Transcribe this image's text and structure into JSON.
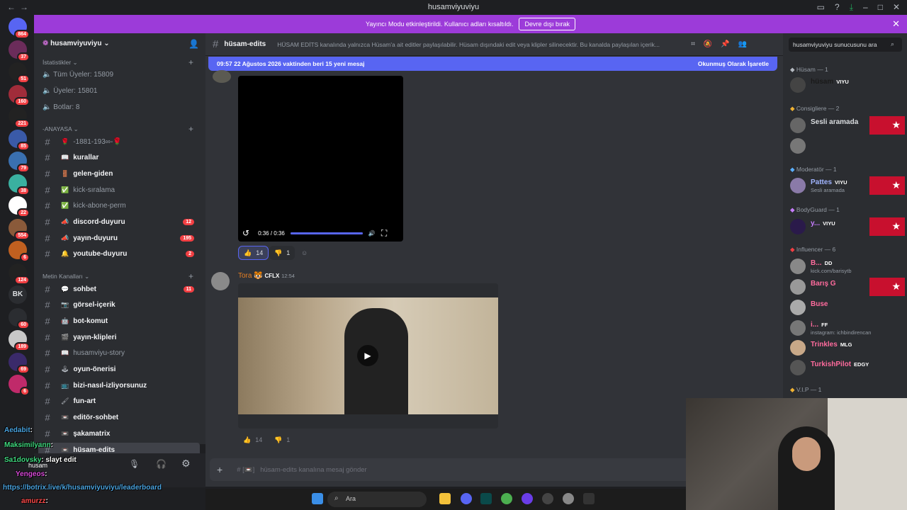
{
  "window": {
    "title": "husamviyuviyu"
  },
  "banner": {
    "text": "Yayıncı Modu etkinleştirildi. Kullanıcı adları kısaltıldı.",
    "button": "Devre dışı bırak",
    "color": "#9c3bd9"
  },
  "rail": {
    "badges": [
      "864",
      "37",
      "51",
      "160",
      "221",
      "85",
      "79",
      "38",
      "22",
      "554",
      "6",
      "124",
      "BK",
      "60",
      "189",
      "69",
      "6"
    ]
  },
  "server": {
    "name": "husamviyuviyu"
  },
  "stats": {
    "category": "İstatistikler",
    "all_members": "Tüm Üyeler: 15809",
    "members": "Üyeler: 15801",
    "bots": "Botlar: 8"
  },
  "cat_anayasa": {
    "label": "-ANAYASA"
  },
  "cat_metin": {
    "label": "Metin Kanalları"
  },
  "channels_anayasa": [
    {
      "emoji": "🌹",
      "name": "-1881-193∞-🌹",
      "dim": true,
      "count": ""
    },
    {
      "emoji": "📖",
      "name": "kurallar",
      "dim": false,
      "count": ""
    },
    {
      "emoji": "🚪",
      "name": "gelen-giden",
      "dim": false,
      "count": ""
    },
    {
      "emoji": "✅",
      "name": "kick-sıralama",
      "dim": true,
      "count": ""
    },
    {
      "emoji": "✅",
      "name": "kick-abone-perm",
      "dim": true,
      "count": ""
    },
    {
      "emoji": "📣",
      "name": "discord-duyuru",
      "dim": false,
      "count": "12"
    },
    {
      "emoji": "📣",
      "name": "yayın-duyuru",
      "dim": false,
      "count": "195"
    },
    {
      "emoji": "🔔",
      "name": "youtube-duyuru",
      "dim": false,
      "count": "2"
    }
  ],
  "channels_metin": [
    {
      "emoji": "💬",
      "name": "sohbet",
      "dim": false,
      "count": "11"
    },
    {
      "emoji": "📷",
      "name": "görsel-içerik",
      "dim": false,
      "count": ""
    },
    {
      "emoji": "🤖",
      "name": "bot-komut",
      "dim": false,
      "count": ""
    },
    {
      "emoji": "🎬",
      "name": "yayın-klipleri",
      "dim": false,
      "count": ""
    },
    {
      "emoji": "📖",
      "name": "husamviyu-story",
      "dim": true,
      "count": ""
    },
    {
      "emoji": "🕹",
      "name": "oyun-önerisi",
      "dim": false,
      "count": ""
    },
    {
      "emoji": "📺",
      "name": "bizi-nasıl-izliyorsunuz",
      "dim": false,
      "count": ""
    },
    {
      "emoji": "🖌",
      "name": "fun-art",
      "dim": false,
      "count": ""
    },
    {
      "emoji": "📼",
      "name": "editör-sohbet",
      "dim": false,
      "count": ""
    },
    {
      "emoji": "📼",
      "name": "şakamatrix",
      "dim": false,
      "count": ""
    },
    {
      "emoji": "📼",
      "name": "hüsam-edits",
      "dim": false,
      "count": ""
    }
  ],
  "user": {
    "name": "husam"
  },
  "header": {
    "channel": "hüsam-edits",
    "topic": "HÜSAM EDİTS kanalında yalnızca Hüsam'a ait editler paylaşılabilir. Hüsam dışındaki edit veya klipler silinecektir. Bu kanalda paylaşılan içerik...",
    "search_placeholder": "husamviyuviyu sunucusunu ara"
  },
  "newbar": {
    "text": "09:57 22 Ağustos 2026 vaktinden beri 15 yeni mesaj",
    "action": "Okunmuş Olarak İşaretle"
  },
  "video1": {
    "time": "0:36 / 0:36",
    "progress": 1.0
  },
  "reactions1": {
    "thumbs": "14",
    "down": "1"
  },
  "message2": {
    "author": "Tora 🐯",
    "tag": "CFLX",
    "time": "12:54"
  },
  "reactions2": {
    "thumbs": "14",
    "down": "1"
  },
  "composer": {
    "placeholder": "hüsam-edits kanalına mesaj gönder"
  },
  "members": {
    "roles": [
      {
        "label": "Hüsam — 1"
      },
      {
        "label": "Consigliere — 2"
      },
      {
        "label": "Moderatör — 1"
      },
      {
        "label": "BodyGuard — 1"
      },
      {
        "label": "Influencer — 6"
      },
      {
        "label": "V.I.P — 1"
      }
    ],
    "list": [
      {
        "name": "hüsam",
        "tag": "VIYU",
        "sub": "",
        "color": "#1a1a1a"
      },
      {
        "name": "Sesli aramada",
        "tag": "",
        "sub": "",
        "color": "#dbdee1"
      },
      {
        "name": "",
        "tag": "",
        "sub": "",
        "color": "#dbdee1"
      },
      {
        "name": "Pattes",
        "tag": "VIYU",
        "sub": "Sesli aramada",
        "color": "#a0b4ff"
      },
      {
        "name": "y...",
        "tag": "VIYU",
        "sub": "",
        "color": "#c77dff"
      },
      {
        "name": "B...",
        "tag": "DD",
        "sub": "kick.com/barisytb",
        "color": "#ff6b9d"
      },
      {
        "name": "Barış G",
        "tag": "",
        "sub": "",
        "color": "#ff6b9d"
      },
      {
        "name": "Buse",
        "tag": "",
        "sub": "",
        "color": "#ff6b9d"
      },
      {
        "name": "i...",
        "tag": "FF",
        "sub": "instagram: ichbindirencan",
        "color": "#ff6b9d"
      },
      {
        "name": "Trinkles",
        "tag": "MLG",
        "sub": "",
        "color": "#ff6b9d"
      },
      {
        "name": "TurkishPilot",
        "tag": "EDGY",
        "sub": "",
        "color": "#ff6b9d"
      }
    ]
  },
  "chat_overlay": [
    {
      "user": "Aedabit",
      "text": ":",
      "color": "#4aa3df"
    },
    {
      "user": "Maksimilyann",
      "text": ":",
      "color": "#3fd97e"
    },
    {
      "user": "Sa1dovsky",
      "text": ": slayt edit",
      "color": "#3fd97e"
    },
    {
      "user": "Yengeos",
      "text": ":",
      "color": "#d94ad9"
    },
    {
      "user": "",
      "text": "https://botrix.live/k/husamviyuviyu/leaderboard",
      "color": "#4aa3df"
    },
    {
      "user": "amurzz",
      "text": ":",
      "color": "#ff4a4a"
    }
  ],
  "taskbar": {
    "search": "Ara"
  }
}
